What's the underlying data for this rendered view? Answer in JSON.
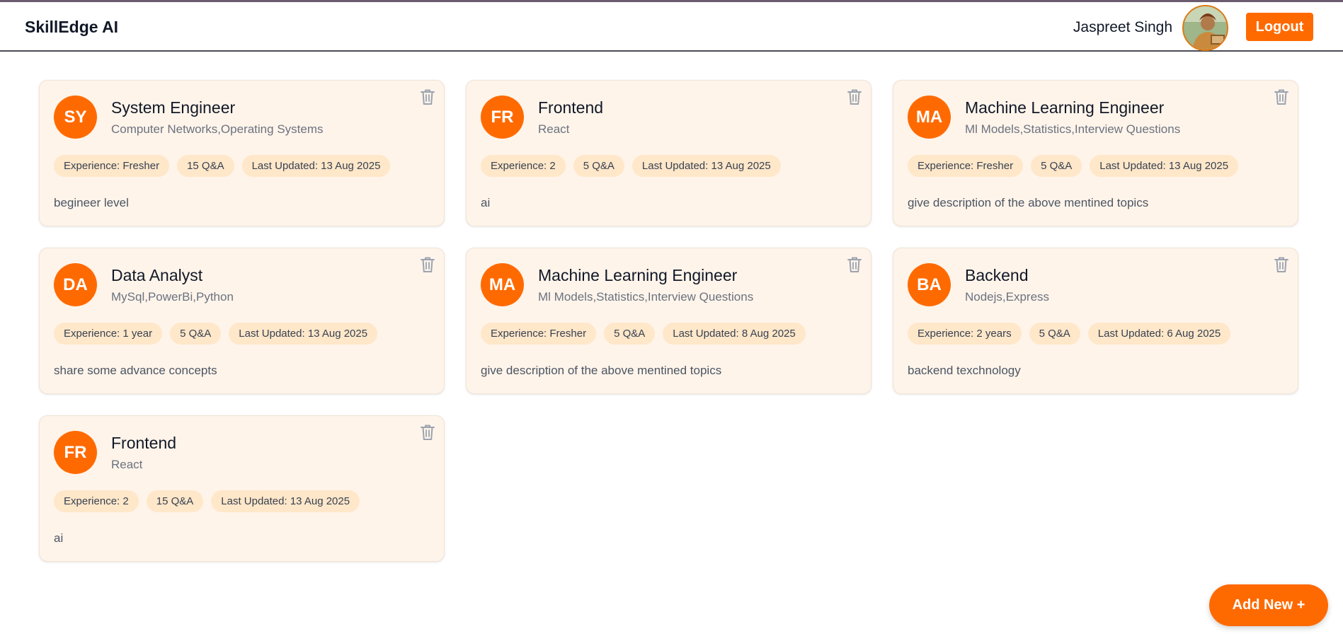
{
  "header": {
    "brand": "SkillEdge AI",
    "user_name": "Jaspreet Singh",
    "logout_label": "Logout"
  },
  "sessions": [
    {
      "initials": "SY",
      "title": "System Engineer",
      "topics": "Computer Networks,Operating Systems",
      "experience": "Experience: Fresher",
      "qa": "15 Q&A",
      "updated": "Last Updated: 13 Aug 2025",
      "description": "begineer level"
    },
    {
      "initials": "FR",
      "title": "Frontend",
      "topics": "React",
      "experience": "Experience: 2",
      "qa": "5 Q&A",
      "updated": "Last Updated: 13 Aug 2025",
      "description": "ai"
    },
    {
      "initials": "MA",
      "title": "Machine Learning Engineer",
      "topics": "Ml Models,Statistics,Interview Questions",
      "experience": "Experience: Fresher",
      "qa": "5 Q&A",
      "updated": "Last Updated: 13 Aug 2025",
      "description": "give description of the above mentined topics"
    },
    {
      "initials": "DA",
      "title": "Data Analyst",
      "topics": "MySql,PowerBi,Python",
      "experience": "Experience: 1 year",
      "qa": "5 Q&A",
      "updated": "Last Updated: 13 Aug 2025",
      "description": "share some advance concepts"
    },
    {
      "initials": "MA",
      "title": "Machine Learning Engineer",
      "topics": "Ml Models,Statistics,Interview Questions",
      "experience": "Experience: Fresher",
      "qa": "5 Q&A",
      "updated": "Last Updated: 8 Aug 2025",
      "description": "give description of the above mentined topics"
    },
    {
      "initials": "BA",
      "title": "Backend",
      "topics": "Nodejs,Express",
      "experience": "Experience: 2 years",
      "qa": "5 Q&A",
      "updated": "Last Updated: 6 Aug 2025",
      "description": "backend texchnology"
    },
    {
      "initials": "FR",
      "title": "Frontend",
      "topics": "React",
      "experience": "Experience: 2",
      "qa": "15 Q&A",
      "updated": "Last Updated: 13 Aug 2025",
      "description": "ai"
    }
  ],
  "fab": {
    "label": "Add New +"
  },
  "colors": {
    "accent": "#ff6a00",
    "card_bg": "#fff4ea",
    "tag_bg": "#ffe7c9"
  },
  "icons": {
    "delete": "trash-icon",
    "user": "avatar"
  }
}
